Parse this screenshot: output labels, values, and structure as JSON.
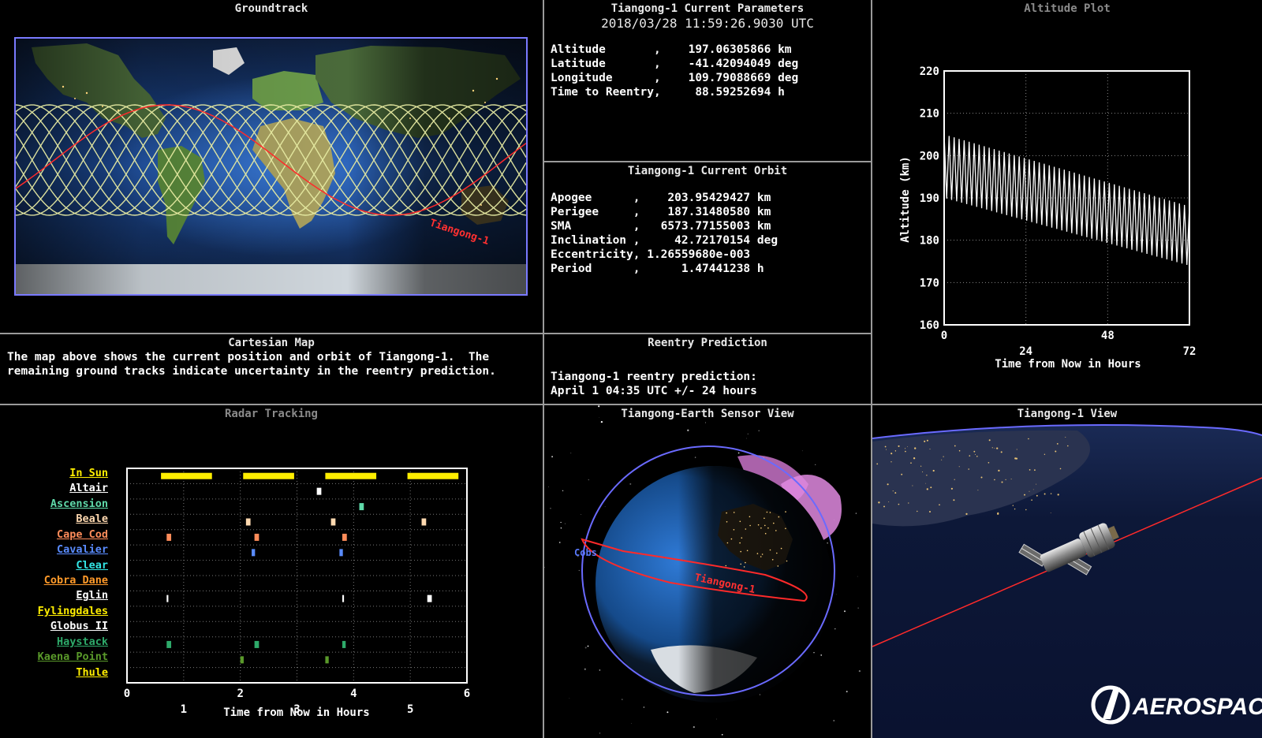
{
  "groundtrack": {
    "title": "Groundtrack",
    "sat_label": "Tiangong-1"
  },
  "params": {
    "title": "Tiangong-1 Current Parameters",
    "timestamp": "2018/03/28 11:59:26.9030 UTC",
    "rows": [
      "Altitude       ,    197.06305866 km",
      "Latitude       ,    -41.42094049 deg",
      "Longitude      ,    109.79088669 deg",
      "Time to Reentry,     88.59252694 h"
    ]
  },
  "orbit": {
    "title": "Tiangong-1 Current Orbit",
    "rows": [
      "Apogee      ,    203.95429427 km",
      "Perigee     ,    187.31480580 km",
      "SMA         ,   6573.77155003 km",
      "Inclination ,     42.72170154 deg",
      "Eccentricity, 1.26559680e-003",
      "Period      ,      1.47441238 h"
    ]
  },
  "cartesian": {
    "title": "Cartesian Map",
    "lines": [
      "The map above shows the current position and orbit of Tiangong-1.  The",
      "remaining ground tracks indicate uncertainty in the reentry prediction."
    ]
  },
  "reentry": {
    "title": "Reentry Prediction",
    "lines": [
      "Tiangong-1 reentry prediction:",
      "April 1 04:35 UTC +/- 24 hours"
    ]
  },
  "altitude": {
    "title": "Altitude Plot",
    "ylabel": "Altitude (km)",
    "xlabel": "Time from Now in Hours",
    "yticks": [
      "220",
      "210",
      "200",
      "190",
      "180",
      "170",
      "160"
    ],
    "xticks_top": [
      "0",
      "48"
    ],
    "xticks_bottom": [
      "24",
      "72"
    ]
  },
  "radar": {
    "title": "Radar Tracking",
    "xlabel": "Time from Now in Hours",
    "xticks_top": [
      "0",
      "2",
      "4",
      "6"
    ],
    "xticks_bottom": [
      "1",
      "3",
      "5"
    ],
    "stations": [
      {
        "name": "In Sun",
        "color": "#ffee00"
      },
      {
        "name": "Altair",
        "color": "#ffffff"
      },
      {
        "name": "Ascension",
        "color": "#5fd9a9"
      },
      {
        "name": "Beale",
        "color": "#ffd9b0"
      },
      {
        "name": "Cape Cod",
        "color": "#ff8c5a"
      },
      {
        "name": "Cavalier",
        "color": "#5a8cff"
      },
      {
        "name": "Clear",
        "color": "#33e6e6"
      },
      {
        "name": "Cobra Dane",
        "color": "#ff9a2a"
      },
      {
        "name": "Eglin",
        "color": "#ffffff"
      },
      {
        "name": "Fylingdales",
        "color": "#ffee00"
      },
      {
        "name": "Globus II",
        "color": "#ffffff"
      },
      {
        "name": "Haystack",
        "color": "#2eaa6a"
      },
      {
        "name": "Kaena Point",
        "color": "#5a9a2a"
      },
      {
        "name": "Thule",
        "color": "#ffee00"
      }
    ]
  },
  "sensor": {
    "title": "Tiangong-Earth Sensor View",
    "sat_label": "Tiangong-1",
    "station_label": "Cobs"
  },
  "satview": {
    "title": "Tiangong-1 View"
  },
  "logo": {
    "text": "AEROSPACE"
  },
  "chart_data": [
    {
      "type": "line",
      "title": "Altitude Plot",
      "xlabel": "Time from Now in Hours",
      "ylabel": "Altitude (km)",
      "xlim": [
        0,
        72
      ],
      "ylim": [
        160,
        220
      ],
      "series": [
        {
          "values": {
            "x": [
              0,
              72
            ],
            "apogee": [
              205,
              188
            ],
            "perigee": [
              190,
              174
            ]
          }
        }
      ]
    },
    {
      "type": "bar",
      "title": "Radar Tracking",
      "xlabel": "Time from Now in Hours",
      "xlim": [
        0,
        6
      ],
      "passes": {
        "In Sun": [
          [
            0.6,
            1.5
          ],
          [
            2.05,
            2.95
          ],
          [
            3.5,
            4.4
          ],
          [
            4.95,
            5.85
          ]
        ],
        "Altair": [
          [
            3.35,
            3.43
          ]
        ],
        "Ascension": [
          [
            4.1,
            4.18
          ]
        ],
        "Beale": [
          [
            2.1,
            2.18
          ],
          [
            3.6,
            3.68
          ],
          [
            5.2,
            5.28
          ]
        ],
        "Cape Cod": [
          [
            0.7,
            0.78
          ],
          [
            2.25,
            2.33
          ],
          [
            3.8,
            3.88
          ]
        ],
        "Cavalier": [
          [
            2.2,
            2.26
          ],
          [
            3.75,
            3.81
          ]
        ],
        "Eglin": [
          [
            0.7,
            0.73
          ],
          [
            3.8,
            3.83
          ],
          [
            5.3,
            5.38
          ]
        ],
        "Haystack": [
          [
            0.7,
            0.78
          ],
          [
            2.25,
            2.33
          ],
          [
            3.8,
            3.86
          ]
        ],
        "Kaena Point": [
          [
            2.0,
            2.06
          ],
          [
            3.5,
            3.56
          ]
        ]
      }
    }
  ]
}
